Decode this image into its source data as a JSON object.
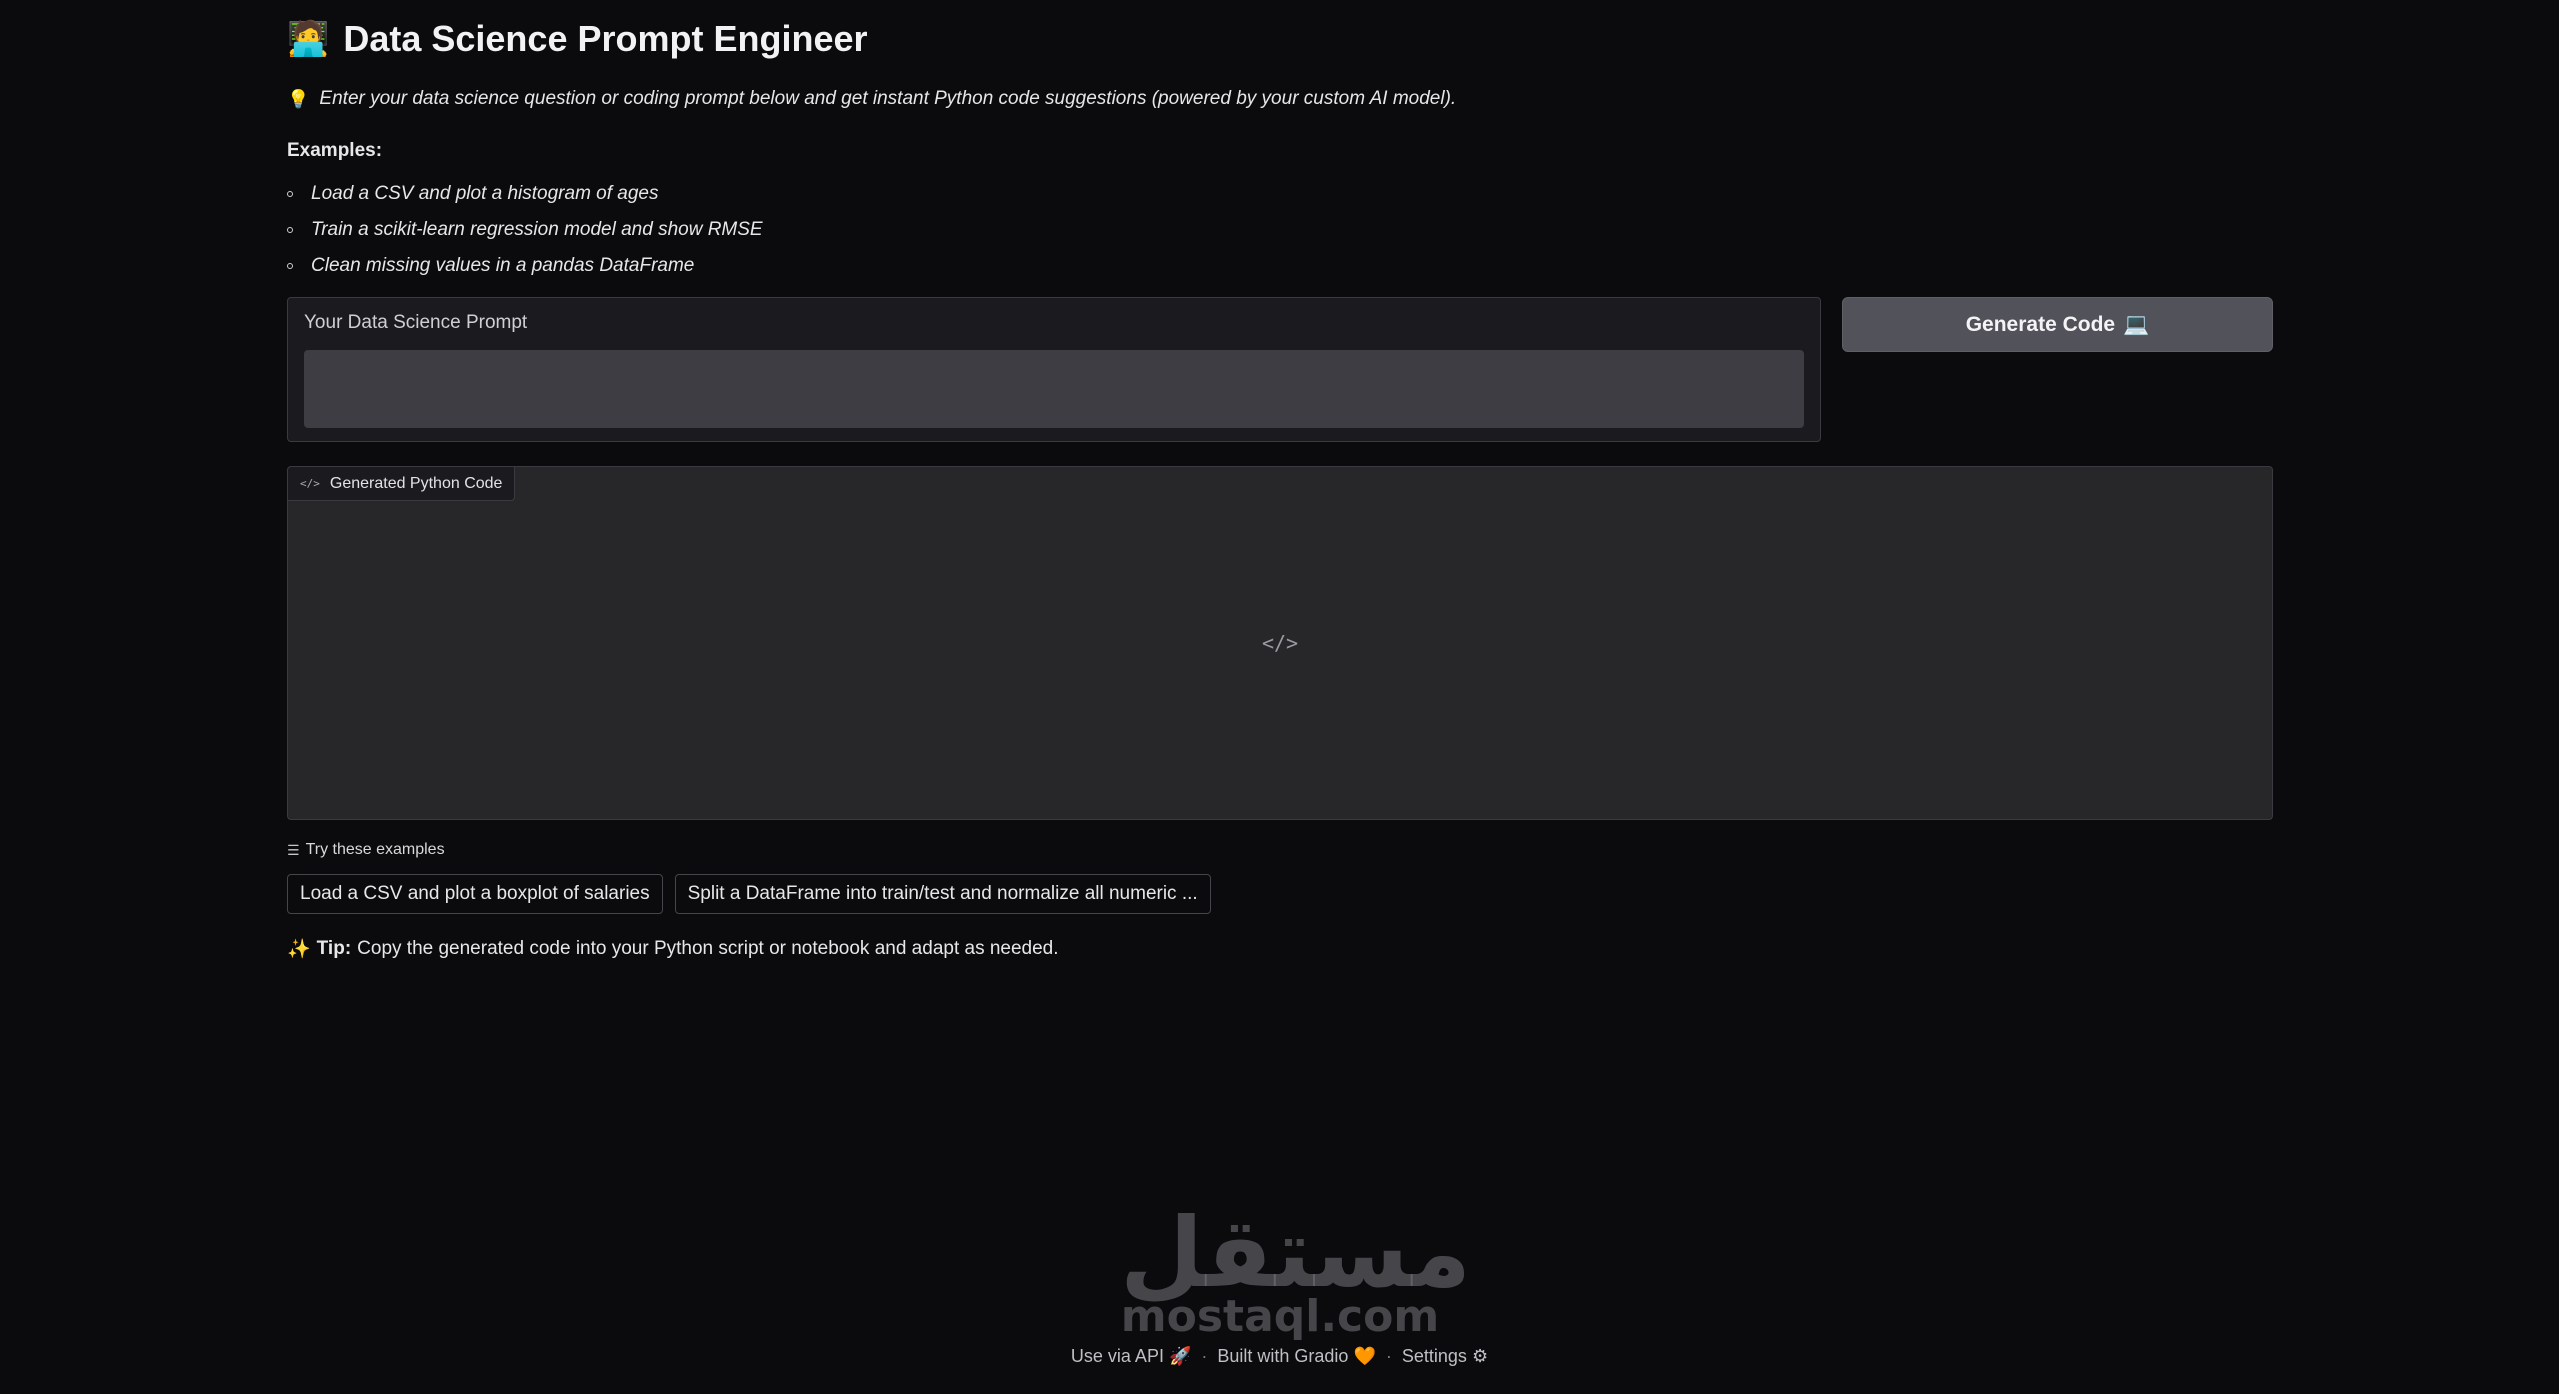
{
  "header": {
    "emoji": "🧑‍💻",
    "title": "Data Science Prompt Engineer"
  },
  "intro": {
    "icon": "💡",
    "text": "Enter your data science question or coding prompt below and get instant Python code suggestions (powered by your custom AI model)."
  },
  "examples": {
    "label": "Examples:",
    "items": [
      "Load a CSV and plot a histogram of ages",
      "Train a scikit-learn regression model and show RMSE",
      "Clean missing values in a pandas DataFrame"
    ]
  },
  "prompt": {
    "label": "Your Data Science Prompt",
    "value": "",
    "placeholder": ""
  },
  "generate_button": {
    "label": "Generate Code",
    "icon": "💻"
  },
  "code_output": {
    "tab_icon": "</>",
    "tab_label": "Generated Python Code",
    "empty_icon": "</>"
  },
  "try_examples": {
    "icon": "☰",
    "label": "Try these examples",
    "chips": [
      "Load a CSV and plot a boxplot of salaries",
      "Split a DataFrame into train/test and normalize all numeric ..."
    ]
  },
  "tip": {
    "icon": "✨",
    "label": "Tip:",
    "text": "Copy the generated code into your Python script or notebook and adapt as needed."
  },
  "watermark": {
    "arabic": "مستقل",
    "latin": "mostaql.com"
  },
  "footer": {
    "api_label": "Use via API",
    "api_icon": "🚀",
    "built_label": "Built with Gradio",
    "built_icon": "🧡",
    "settings_label": "Settings",
    "settings_icon": "⚙",
    "separator": "·"
  }
}
